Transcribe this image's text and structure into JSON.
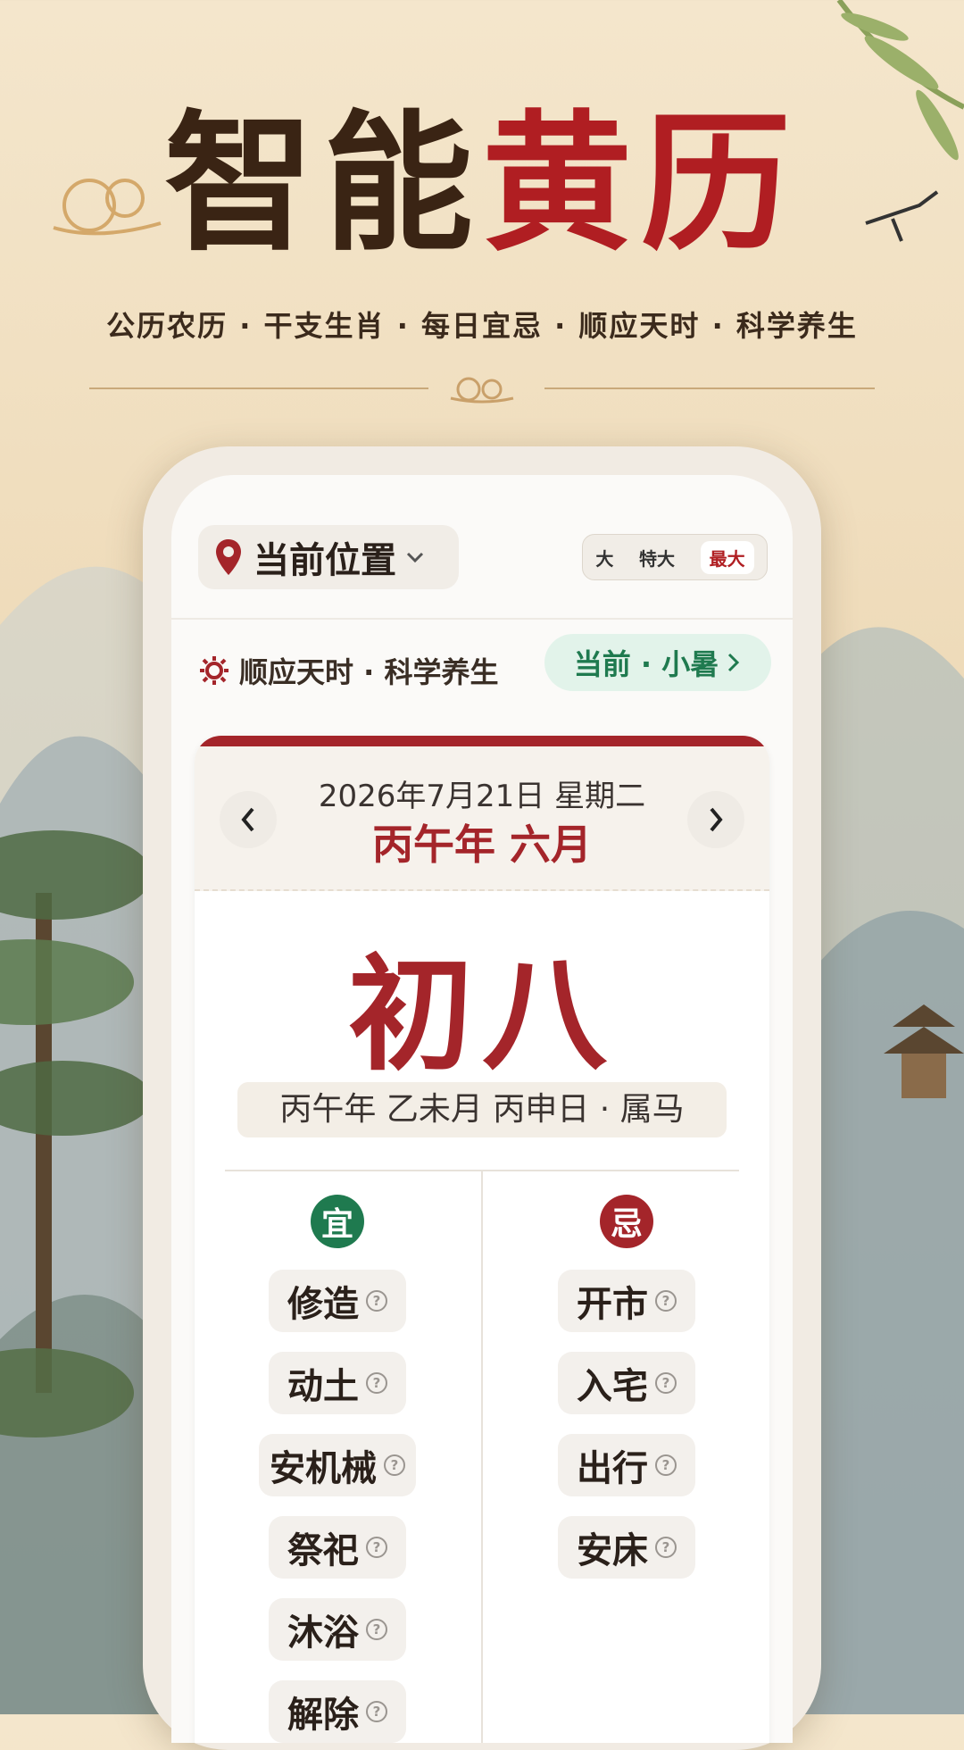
{
  "poster": {
    "title_dark": "智能",
    "title_red": "黄历",
    "subtitle": "公历农历 · 干支生肖 · 每日宜忌 · 顺应天时 · 科学养生"
  },
  "header": {
    "location_label": "当前位置",
    "font_sizes": [
      "大",
      "特大",
      "最大"
    ],
    "active_font_size": "最大"
  },
  "banner": {
    "slogan": "顺应天时 · 科学养生",
    "solar_term": "当前 · 小暑"
  },
  "calendar": {
    "gregorian": "2026年7月21日 星期二",
    "lunar_month": "丙午年 六月",
    "lunar_day": "初八",
    "ganzhi": "丙午年 乙未月 丙申日 · 属马"
  },
  "yi": {
    "badge": "宜",
    "items": [
      "修造",
      "动土",
      "安机械",
      "祭祀",
      "沐浴",
      "解除"
    ]
  },
  "ji": {
    "badge": "忌",
    "items": [
      "开市",
      "入宅",
      "出行",
      "安床"
    ]
  },
  "colors": {
    "accent_red": "#a4252a",
    "green": "#1f7a4f"
  }
}
